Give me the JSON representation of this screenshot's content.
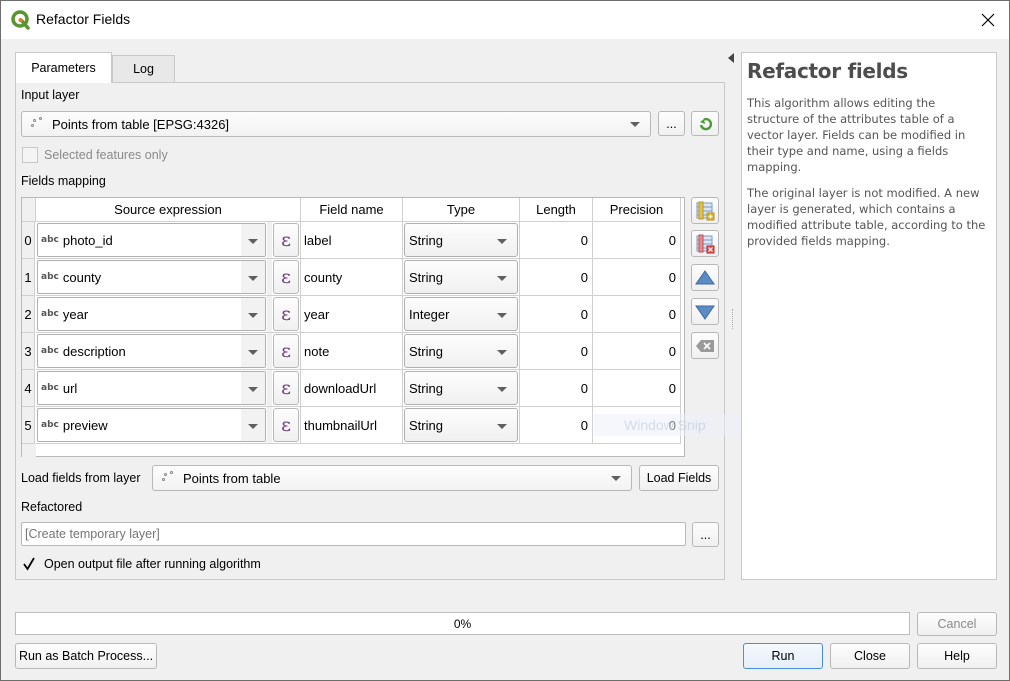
{
  "window": {
    "title": "Refactor Fields",
    "close_label": "Close window"
  },
  "tabs": [
    {
      "label": "Parameters",
      "active": true
    },
    {
      "label": "Log",
      "active": false
    }
  ],
  "input_layer": {
    "label": "Input layer",
    "value": "Points from table [EPSG:4326]",
    "browse_label": "...",
    "selected_only_label": "Selected features only",
    "selected_only_checked": false
  },
  "fields_mapping": {
    "label": "Fields mapping",
    "columns": [
      "Source expression",
      "Field name",
      "Type",
      "Length",
      "Precision"
    ],
    "rows": [
      {
        "index": "0",
        "source": "photo_id",
        "source_type": "abc",
        "field_name": "label",
        "type": "String",
        "length": "0",
        "precision": "0"
      },
      {
        "index": "1",
        "source": "county",
        "source_type": "abc",
        "field_name": "county",
        "type": "String",
        "length": "0",
        "precision": "0"
      },
      {
        "index": "2",
        "source": "year",
        "source_type": "abc",
        "field_name": "year",
        "type": "Integer",
        "length": "0",
        "precision": "0"
      },
      {
        "index": "3",
        "source": "description",
        "source_type": "abc",
        "field_name": "note",
        "type": "String",
        "length": "0",
        "precision": "0"
      },
      {
        "index": "4",
        "source": "url",
        "source_type": "abc",
        "field_name": "downloadUrl",
        "type": "String",
        "length": "0",
        "precision": "0"
      },
      {
        "index": "5",
        "source": "preview",
        "source_type": "abc",
        "field_name": "thumbnailUrl",
        "type": "String",
        "length": "0",
        "precision": "0"
      }
    ],
    "expression_glyph": "ε"
  },
  "load_fields": {
    "label": "Load fields from layer",
    "value": "Points from table",
    "button_label": "Load Fields"
  },
  "refactored": {
    "label": "Refactored",
    "placeholder": "[Create temporary layer]",
    "browse_label": "..."
  },
  "open_output": {
    "label": "Open output file after running algorithm",
    "checked": true
  },
  "help": {
    "title": "Refactor fields",
    "paragraphs": [
      "This algorithm allows editing the structure of the attributes table of a vector layer. Fields can be modified in their type and name, using a fields mapping.",
      "The original layer is not modified. A new layer is generated, which contains a modified attribute table, according to the provided fields mapping."
    ]
  },
  "progress": {
    "value_percent": 0,
    "label": "0%"
  },
  "buttons": {
    "cancel": "Cancel",
    "batch": "Run as Batch Process...",
    "run": "Run",
    "close": "Close",
    "help": "Help"
  },
  "overlay": {
    "watermark": "Window Snip"
  },
  "colors": {
    "accent_run_border": "#4a90d9",
    "expression_purple": "#6b3a7a",
    "qgis_green": "#589632"
  }
}
